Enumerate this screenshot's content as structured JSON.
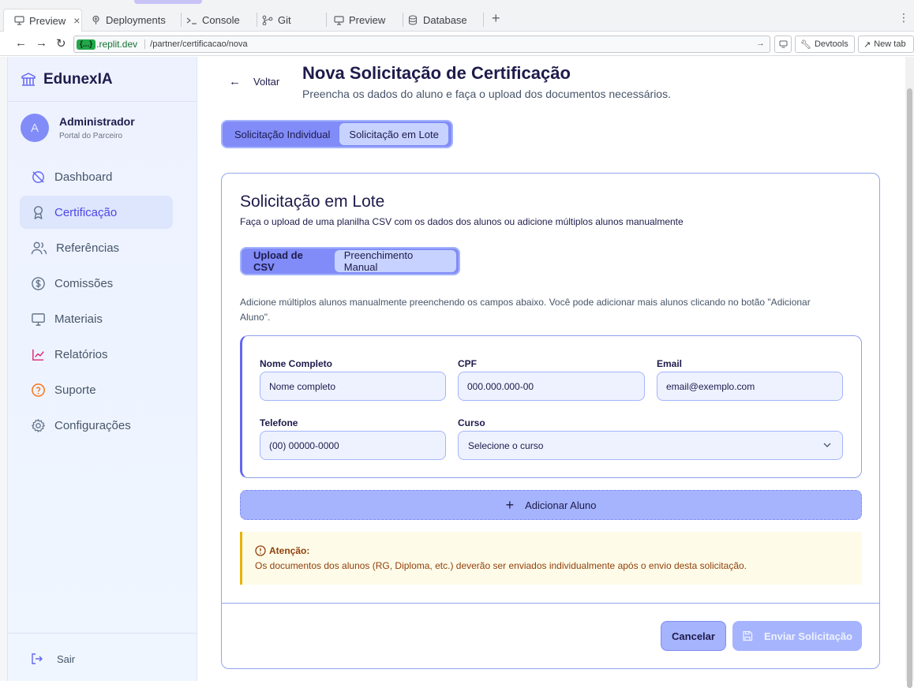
{
  "browser": {
    "tabs": [
      {
        "label": "Preview",
        "icon": "monitor-icon",
        "active": true
      },
      {
        "label": "Deployments",
        "icon": "deployments-icon"
      },
      {
        "label": "Console",
        "icon": "terminal-icon"
      },
      {
        "label": "Git",
        "icon": "git-icon"
      },
      {
        "label": "Preview",
        "icon": "monitor-icon"
      },
      {
        "label": "Database",
        "icon": "database-icon"
      }
    ],
    "url_chip": "{...}",
    "url_host": ".replit.dev",
    "url_path": "/partner/certificacao/nova",
    "devtools_label": "Devtools",
    "newtab_label": "New tab"
  },
  "sidebar": {
    "brand": "EdunexIA",
    "user": {
      "initial": "A",
      "name": "Administrador",
      "role": "Portal do Parceiro"
    },
    "items": [
      {
        "label": "Dashboard",
        "icon": "dashboard-icon"
      },
      {
        "label": "Certificação",
        "icon": "award-icon",
        "active": true
      },
      {
        "label": "Referências",
        "icon": "users-icon"
      },
      {
        "label": "Comissões",
        "icon": "dollar-icon"
      },
      {
        "label": "Materiais",
        "icon": "monitor-icon"
      },
      {
        "label": "Relatórios",
        "icon": "chart-icon"
      },
      {
        "label": "Suporte",
        "icon": "help-icon"
      },
      {
        "label": "Configurações",
        "icon": "settings-icon"
      }
    ],
    "logout": "Sair"
  },
  "header": {
    "back": "Voltar",
    "title": "Nova Solicitação de Certificação",
    "subtitle": "Preencha os dados do aluno e faça o upload dos documentos necessários."
  },
  "mode_tabs": [
    "Solicitação Individual",
    "Solicitação em Lote"
  ],
  "batch": {
    "title": "Solicitação em Lote",
    "subtitle": "Faça o upload de uma planilha CSV com os dados dos alunos ou adicione múltiplos alunos manualmente",
    "sub_tabs": [
      "Upload de CSV",
      "Preenchimento Manual"
    ],
    "description": "Adicione múltiplos alunos manualmente preenchendo os campos abaixo. Você pode adicionar mais alunos clicando no botão \"Adicionar Aluno\".",
    "fields": {
      "nome": {
        "label": "Nome Completo",
        "placeholder": "Nome completo"
      },
      "cpf": {
        "label": "CPF",
        "placeholder": "000.000.000-00"
      },
      "email": {
        "label": "Email",
        "placeholder": "email@exemplo.com"
      },
      "telefone": {
        "label": "Telefone",
        "placeholder": "(00) 00000-0000"
      },
      "curso": {
        "label": "Curso",
        "placeholder": "Selecione o curso"
      }
    },
    "add_student": "Adicionar Aluno",
    "alert": {
      "title": "Atenção:",
      "text": "Os documentos dos alunos (RG, Diploma, etc.) deverão ser enviados individualmente após o envio desta solicitação."
    },
    "cancel": "Cancelar",
    "submit": "Enviar Solicitação"
  },
  "colors": {
    "accent": "#818cf8",
    "accent_light": "#a5b4fc",
    "active_nav": "#4f46e5",
    "alert_text": "#92400e"
  }
}
